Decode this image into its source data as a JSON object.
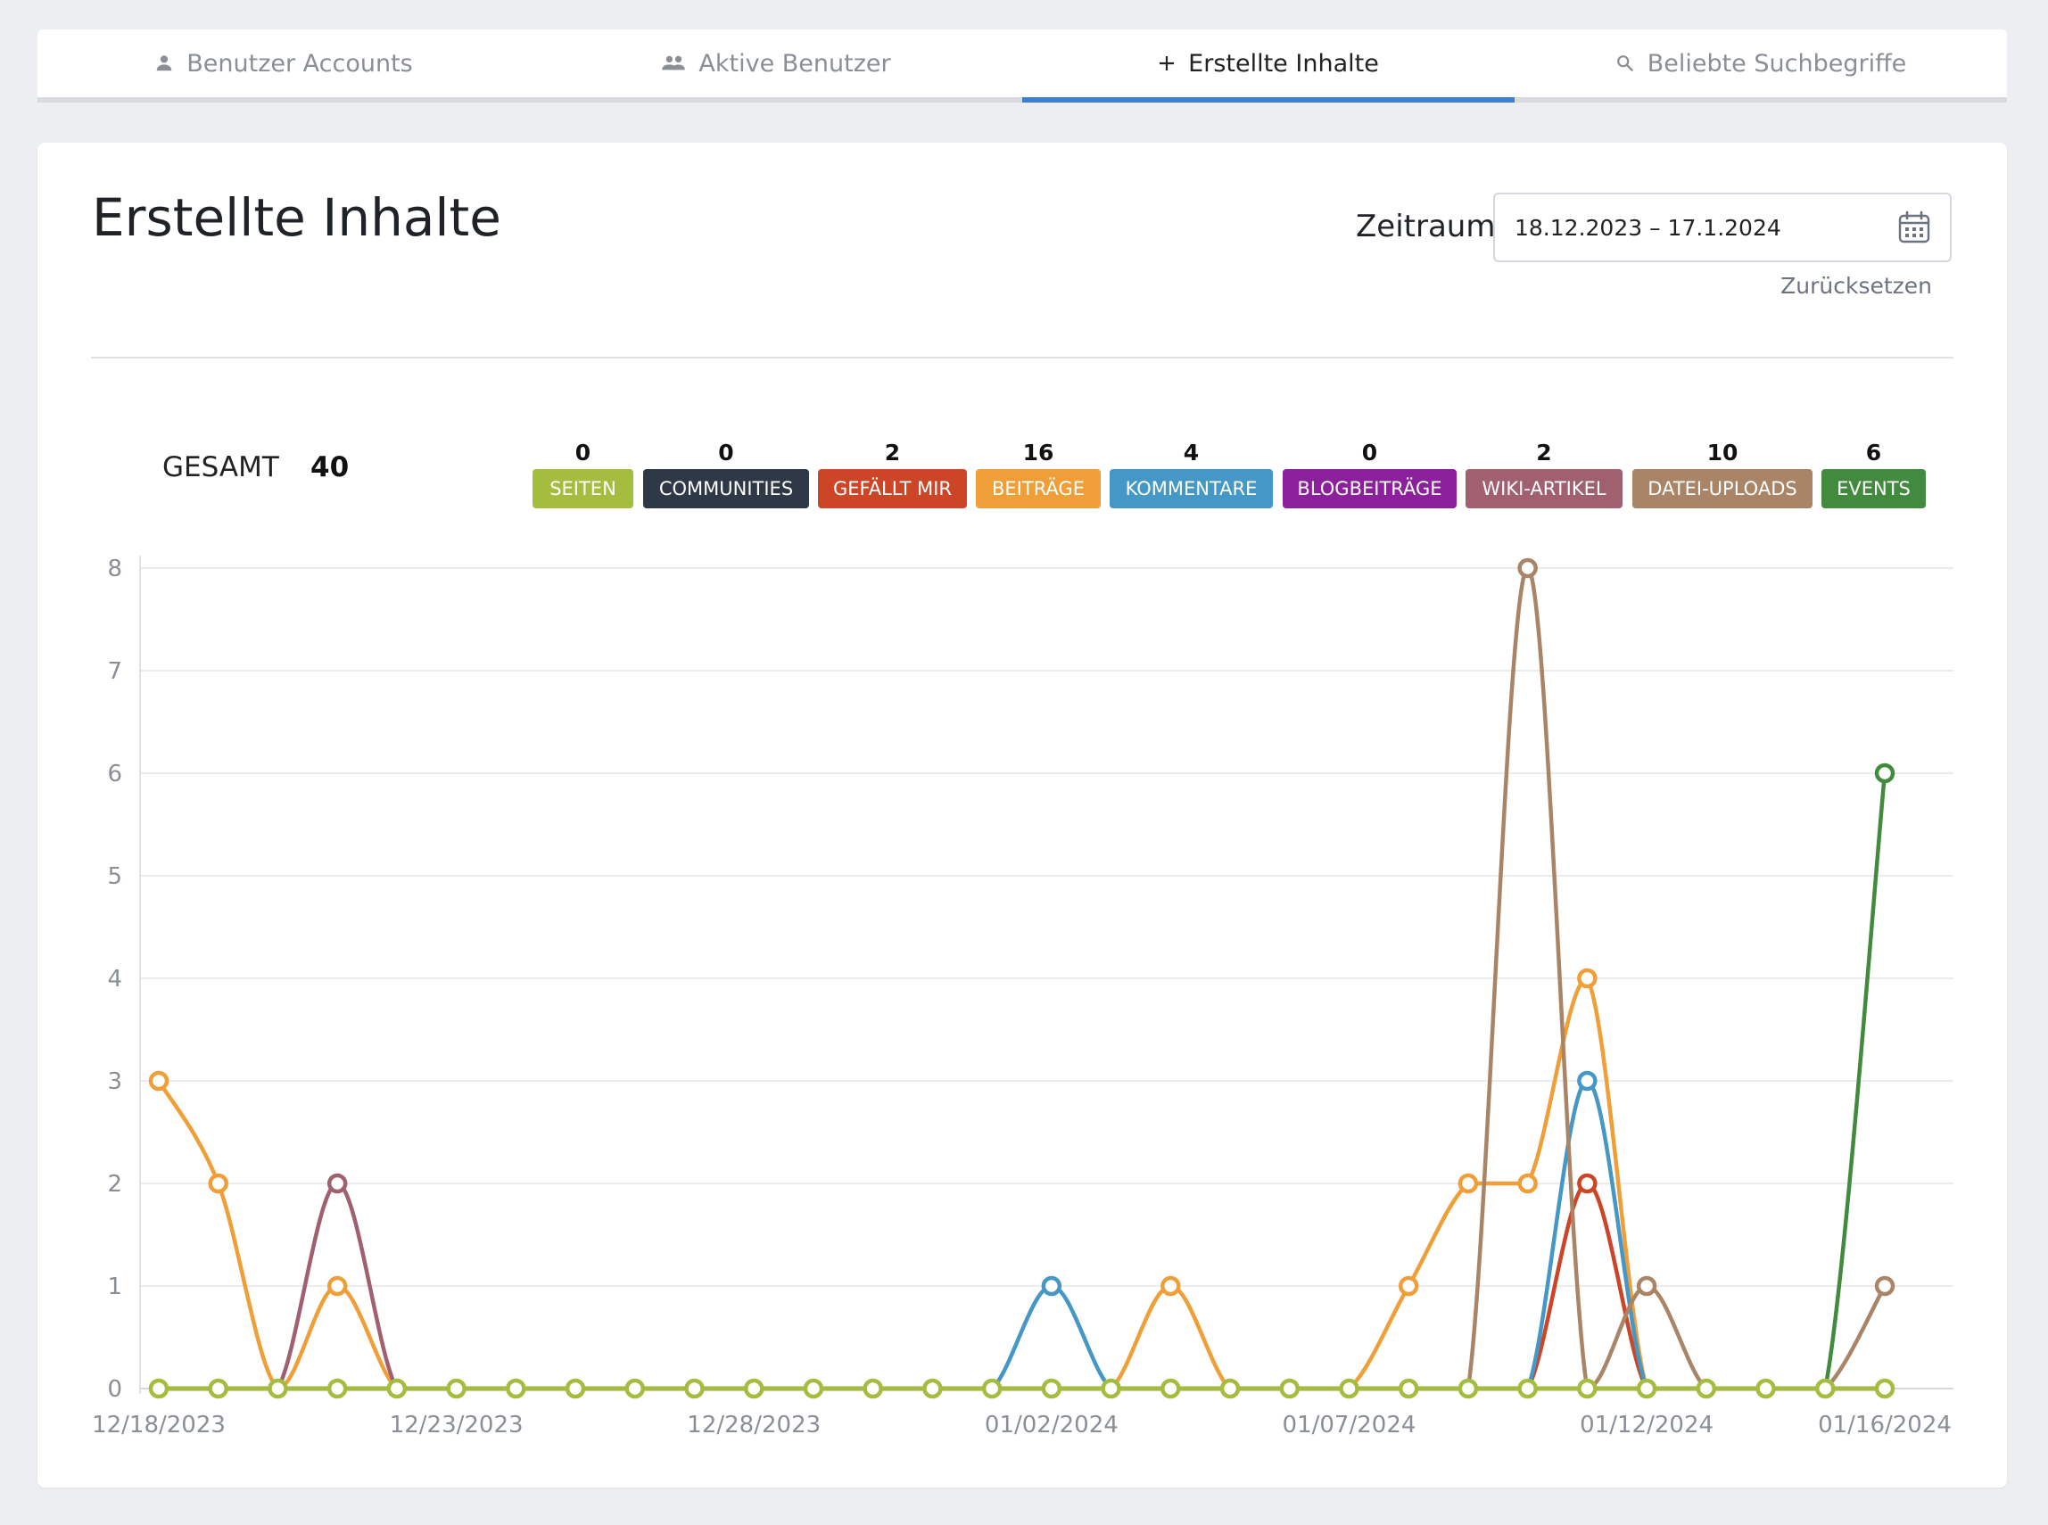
{
  "tabs": [
    {
      "label": "Benutzer Accounts",
      "icon": "person-icon",
      "active": false
    },
    {
      "label": "Aktive Benutzer",
      "icon": "people-icon",
      "active": false
    },
    {
      "label": "Erstellte Inhalte",
      "icon": "plus-icon",
      "active": true
    },
    {
      "label": "Beliebte Suchbegriffe",
      "icon": "search-icon",
      "active": false
    }
  ],
  "page": {
    "title": "Erstellte Inhalte",
    "zeitraum_label": "Zeitraum",
    "date_range": "18.12.2023 – 17.1.2024",
    "reset_label": "Zurücksetzen",
    "gesamt_label": "GESAMT",
    "gesamt_value": "40"
  },
  "legend": [
    {
      "label": "SEITEN",
      "count": "0",
      "color": "#a5bd3f"
    },
    {
      "label": "COMMUNITIES",
      "count": "0",
      "color": "#2f3847"
    },
    {
      "label": "GEFÄLLT MIR",
      "count": "2",
      "color": "#cc4527"
    },
    {
      "label": "BEITRÄGE",
      "count": "16",
      "color": "#f09f38"
    },
    {
      "label": "KOMMENTARE",
      "count": "4",
      "color": "#4597c6"
    },
    {
      "label": "BLOGBEITRÄGE",
      "count": "0",
      "color": "#8c1f9c"
    },
    {
      "label": "WIKI-ARTIKEL",
      "count": "2",
      "color": "#a06070"
    },
    {
      "label": "DATEI-UPLOADS",
      "count": "10",
      "color": "#a98466"
    },
    {
      "label": "EVENTS",
      "count": "6",
      "color": "#428a3d"
    }
  ],
  "chart_data": {
    "type": "line",
    "x": [
      "12/18/2023",
      "12/19/2023",
      "12/20/2023",
      "12/21/2023",
      "12/22/2023",
      "12/23/2023",
      "12/24/2023",
      "12/25/2023",
      "12/26/2023",
      "12/27/2023",
      "12/28/2023",
      "12/29/2023",
      "12/30/2023",
      "12/31/2023",
      "01/01/2024",
      "01/02/2024",
      "01/03/2024",
      "01/04/2024",
      "01/05/2024",
      "01/06/2024",
      "01/07/2024",
      "01/08/2024",
      "01/09/2024",
      "01/10/2024",
      "01/11/2024",
      "01/12/2024",
      "01/13/2024",
      "01/14/2024",
      "01/15/2024",
      "01/16/2024"
    ],
    "x_tick_labels": [
      "12/18/2023",
      "12/23/2023",
      "12/28/2023",
      "01/02/2024",
      "01/07/2024",
      "01/12/2024",
      "01/16/2024"
    ],
    "ylim": [
      0,
      8
    ],
    "y_ticks": [
      0,
      1,
      2,
      3,
      4,
      5,
      6,
      7,
      8
    ],
    "grid": true,
    "series": [
      {
        "name": "SEITEN",
        "color": "#a5bd3f",
        "values": [
          0,
          0,
          0,
          0,
          0,
          0,
          0,
          0,
          0,
          0,
          0,
          0,
          0,
          0,
          0,
          0,
          0,
          0,
          0,
          0,
          0,
          0,
          0,
          0,
          0,
          0,
          0,
          0,
          0,
          0
        ]
      },
      {
        "name": "COMMUNITIES",
        "color": "#2f3847",
        "values": [
          0,
          0,
          0,
          0,
          0,
          0,
          0,
          0,
          0,
          0,
          0,
          0,
          0,
          0,
          0,
          0,
          0,
          0,
          0,
          0,
          0,
          0,
          0,
          0,
          0,
          0,
          0,
          0,
          0,
          0
        ]
      },
      {
        "name": "GEFÄLLT MIR",
        "color": "#cc4527",
        "values": [
          0,
          0,
          0,
          0,
          0,
          0,
          0,
          0,
          0,
          0,
          0,
          0,
          0,
          0,
          0,
          0,
          0,
          0,
          0,
          0,
          0,
          0,
          0,
          0,
          2,
          0,
          0,
          0,
          0,
          0
        ]
      },
      {
        "name": "BEITRÄGE",
        "color": "#f09f38",
        "values": [
          3,
          2,
          0,
          1,
          0,
          0,
          0,
          0,
          0,
          0,
          0,
          0,
          0,
          0,
          0,
          0,
          0,
          1,
          0,
          0,
          0,
          1,
          2,
          2,
          4,
          0,
          0,
          0,
          0,
          0
        ]
      },
      {
        "name": "KOMMENTARE",
        "color": "#4597c6",
        "values": [
          0,
          0,
          0,
          0,
          0,
          0,
          0,
          0,
          0,
          0,
          0,
          0,
          0,
          0,
          0,
          1,
          0,
          0,
          0,
          0,
          0,
          0,
          0,
          0,
          3,
          0,
          0,
          0,
          0,
          0
        ]
      },
      {
        "name": "BLOGBEITRÄGE",
        "color": "#8c1f9c",
        "values": [
          0,
          0,
          0,
          0,
          0,
          0,
          0,
          0,
          0,
          0,
          0,
          0,
          0,
          0,
          0,
          0,
          0,
          0,
          0,
          0,
          0,
          0,
          0,
          0,
          0,
          0,
          0,
          0,
          0,
          0
        ]
      },
      {
        "name": "WIKI-ARTIKEL",
        "color": "#a06070",
        "values": [
          0,
          0,
          0,
          2,
          0,
          0,
          0,
          0,
          0,
          0,
          0,
          0,
          0,
          0,
          0,
          0,
          0,
          0,
          0,
          0,
          0,
          0,
          0,
          0,
          0,
          0,
          0,
          0,
          0,
          0
        ]
      },
      {
        "name": "DATEI-UPLOADS",
        "color": "#a98466",
        "values": [
          0,
          0,
          0,
          0,
          0,
          0,
          0,
          0,
          0,
          0,
          0,
          0,
          0,
          0,
          0,
          0,
          0,
          0,
          0,
          0,
          0,
          0,
          0,
          8,
          0,
          1,
          0,
          0,
          0,
          1
        ]
      },
      {
        "name": "EVENTS",
        "color": "#428a3d",
        "values": [
          0,
          0,
          0,
          0,
          0,
          0,
          0,
          0,
          0,
          0,
          0,
          0,
          0,
          0,
          0,
          0,
          0,
          0,
          0,
          0,
          0,
          0,
          0,
          0,
          0,
          0,
          0,
          0,
          0,
          6
        ]
      }
    ]
  }
}
